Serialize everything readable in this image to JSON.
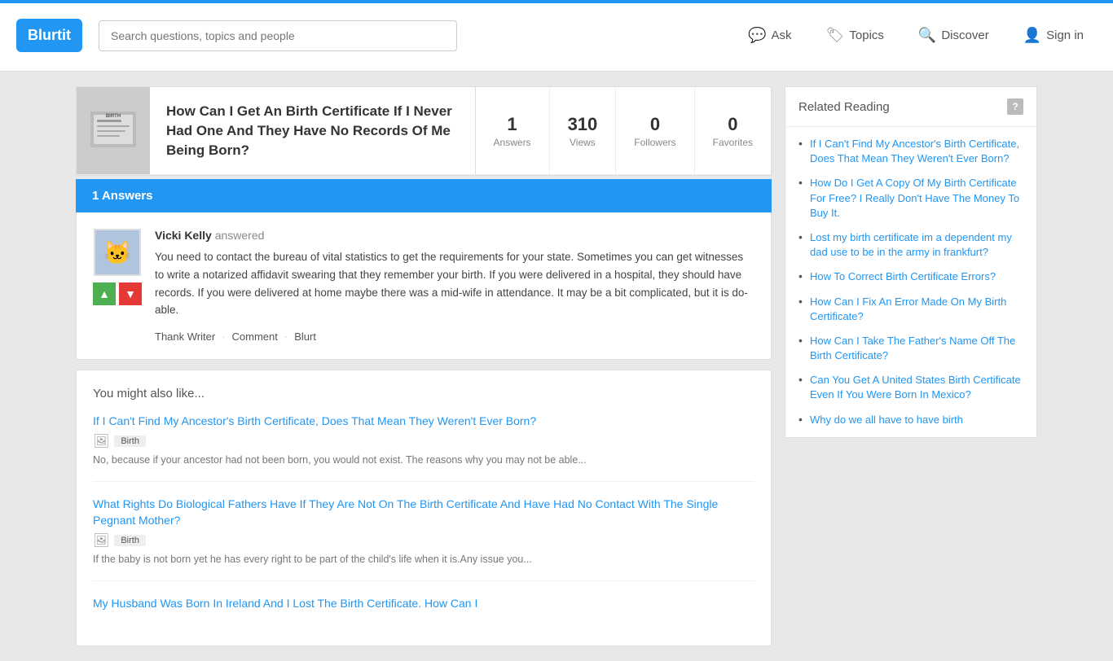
{
  "header": {
    "logo": "Blurtit",
    "search_placeholder": "Search questions, topics and people",
    "nav": [
      {
        "id": "ask",
        "label": "Ask",
        "icon": "💬"
      },
      {
        "id": "topics",
        "label": "Topics",
        "icon": "🏷"
      },
      {
        "id": "discover",
        "label": "Discover",
        "icon": "🔍"
      },
      {
        "id": "signin",
        "label": "Sign in",
        "icon": "👤"
      }
    ]
  },
  "question": {
    "title": "How Can I Get An Birth Certificate If I Never Had One And They Have No Records Of Me Being Born?",
    "stats": {
      "answers": {
        "num": "1",
        "label": "Answers"
      },
      "views": {
        "num": "310",
        "label": "Views"
      },
      "followers": {
        "num": "0",
        "label": "Followers"
      },
      "favorites": {
        "num": "0",
        "label": "Favorites"
      }
    }
  },
  "answers_section": {
    "header": "1 Answers",
    "answers": [
      {
        "author": "Vicki Kelly",
        "action": "answered",
        "body": "You need to contact the bureau of vital statistics to get the requirements for your state.  Sometimes you can get witnesses to write a notarized  affidavit swearing that they remember your birth.  If you were delivered in a hospital, they should have records.  If you were delivered at home maybe there was a mid-wife in attendance.  It may be a bit complicated, but it is do-able.",
        "actions": [
          {
            "id": "thank",
            "label": "Thank Writer"
          },
          {
            "id": "comment",
            "label": "Comment"
          },
          {
            "id": "blurt",
            "label": "Blurt"
          }
        ]
      }
    ]
  },
  "also_like": {
    "title": "You might also like...",
    "items": [
      {
        "link": "If I Can't Find My Ancestor's Birth Certificate, Does That Mean They Weren't Ever Born?",
        "tag": "Birth",
        "snippet": "No, because if your ancestor had not been born, you would not exist. The reasons why you may not be able..."
      },
      {
        "link": "What Rights Do Biological Fathers Have If They Are Not On The Birth Certificate And Have Had No Contact With The Single Pegnant Mother?",
        "tag": "Birth",
        "snippet": "If the baby is not born yet he has every right to be part of the child's life when it is.Any issue you..."
      },
      {
        "link": "My Husband Was Born In Ireland And I Lost The Birth Certificate. How Can I",
        "tag": "",
        "snippet": ""
      }
    ]
  },
  "sidebar": {
    "related_reading": {
      "title": "Related Reading",
      "items": [
        "If I Can't Find My Ancestor's Birth Certificate, Does That Mean They Weren't Ever Born?",
        "How Do I Get A Copy Of My Birth Certificate For Free? I Really Don't Have The Money To Buy It.",
        "Lost my birth certificate im a dependent my dad use to be in the army in frankfurt?",
        "How To Correct Birth Certificate Errors?",
        "How Can I Fix An Error Made On My Birth Certificate?",
        "How Can I Take The Father's Name Off The Birth Certificate?",
        "Can You Get A United States Birth Certificate Even If You Were Born In Mexico?",
        "Why do we all have to have birth"
      ]
    }
  }
}
